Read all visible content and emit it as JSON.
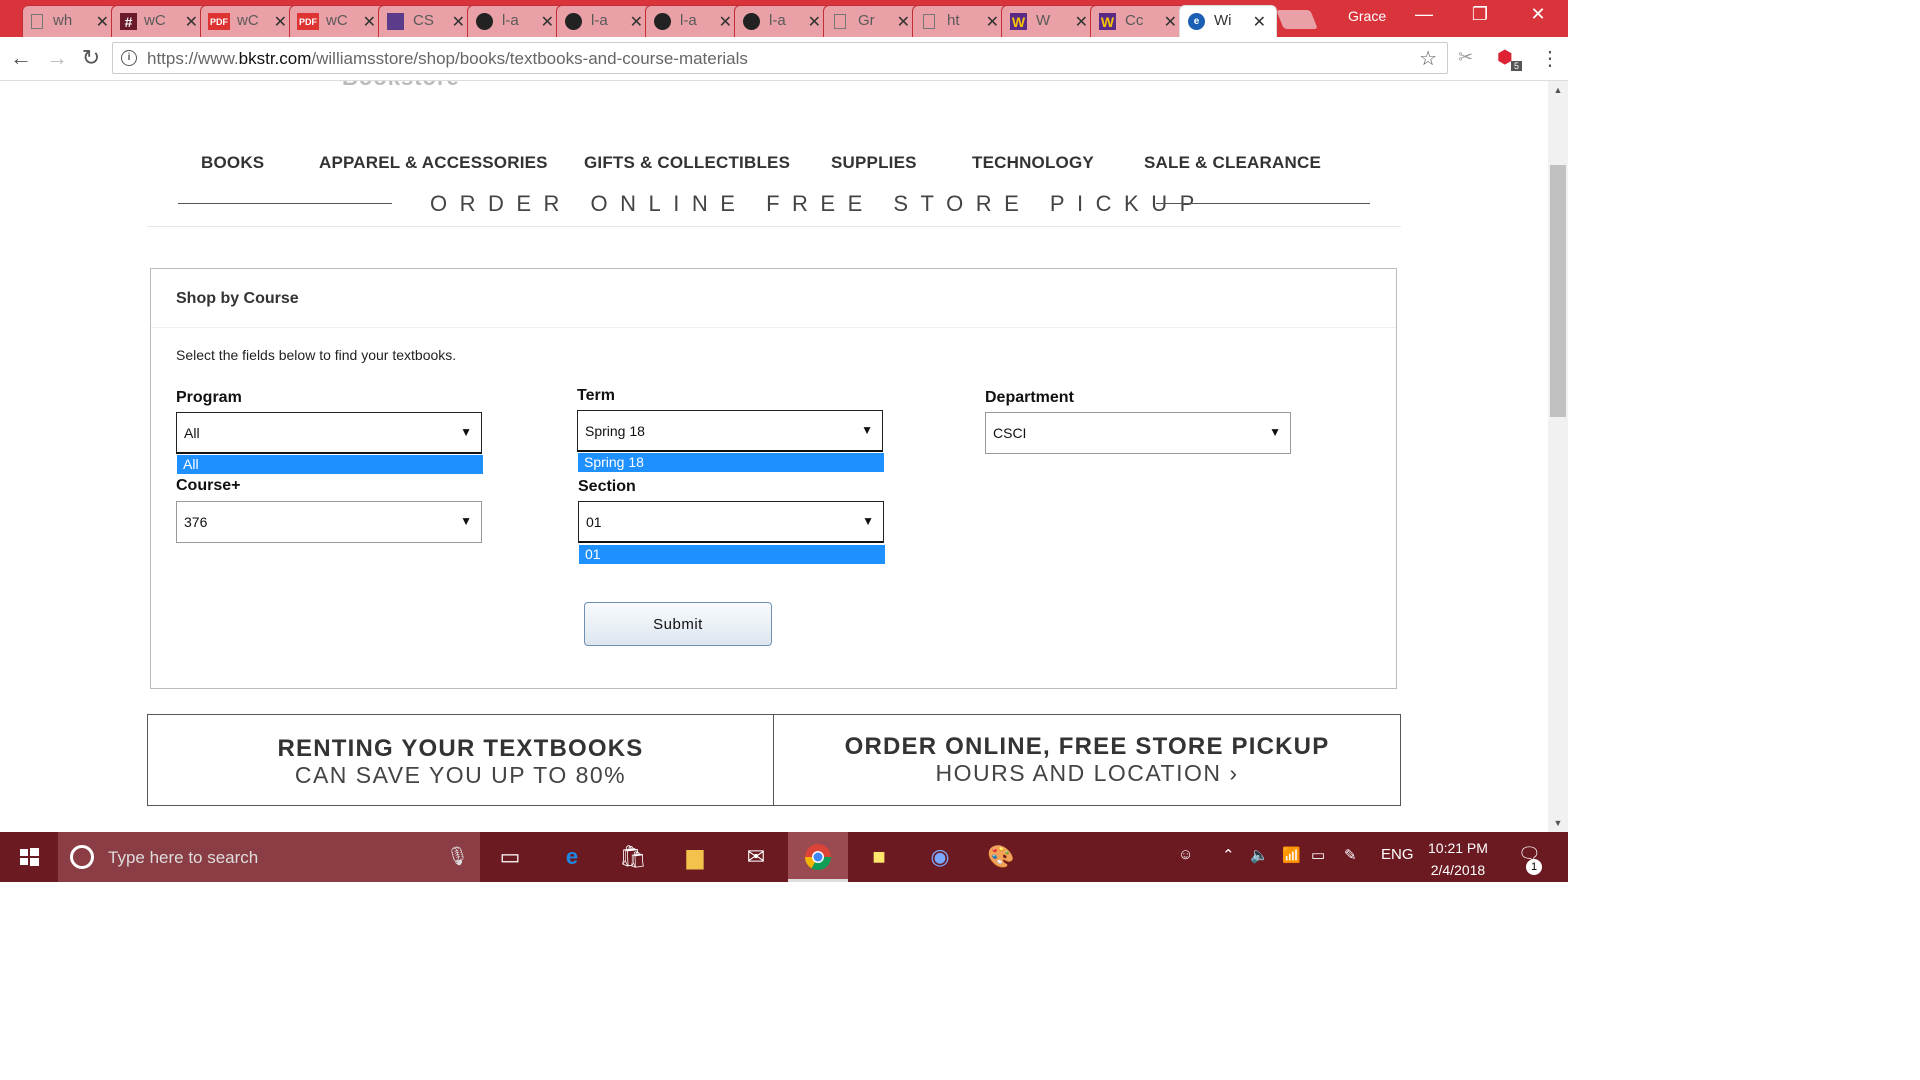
{
  "browser": {
    "tabs": [
      {
        "title": "wh",
        "icon": "document-icon"
      },
      {
        "title": "wC",
        "icon": "hashtag-icon"
      },
      {
        "title": "wC",
        "icon": "pdf-icon"
      },
      {
        "title": "wC",
        "icon": "pdf-icon"
      },
      {
        "title": "CS",
        "icon": "app-icon"
      },
      {
        "title": "l-a",
        "icon": "github-icon"
      },
      {
        "title": "l-a",
        "icon": "github-icon"
      },
      {
        "title": "l-a",
        "icon": "github-icon"
      },
      {
        "title": "l-a",
        "icon": "github-icon"
      },
      {
        "title": "Gr",
        "icon": "document-icon"
      },
      {
        "title": "ht",
        "icon": "document-icon"
      },
      {
        "title": "W",
        "icon": "williams-w-icon"
      },
      {
        "title": "Cc",
        "icon": "williams-w-icon"
      },
      {
        "title": "Wi",
        "icon": "bookstore-icon",
        "active": true
      }
    ],
    "profile_name": "Grace",
    "url_prefix": "https://www.",
    "url_domain": "bkstr.com",
    "url_path": "/williamsstore/shop/books/textbooks-and-course-materials",
    "extension_badge": "5"
  },
  "store": {
    "logo_partial": "Bookstore",
    "nav": [
      "BOOKS",
      "APPAREL & ACCESSORIES",
      "GIFTS & COLLECTIBLES",
      "SUPPLIES",
      "TECHNOLOGY",
      "SALE & CLEARANCE"
    ],
    "tagline": "ORDER ONLINE FREE STORE PICKUP"
  },
  "shop_by_course": {
    "title": "Shop by Course",
    "help_text": "Select the fields below to find your textbooks.",
    "program": {
      "label": "Program",
      "value": "All",
      "open_option": "All"
    },
    "term": {
      "label": "Term",
      "value": "Spring 18",
      "open_option": "Spring 18"
    },
    "department": {
      "label": "Department",
      "value": "CSCI"
    },
    "course": {
      "label": "Course+",
      "value": "376"
    },
    "section": {
      "label": "Section",
      "value": "01",
      "open_option": "01"
    },
    "submit_label": "Submit"
  },
  "promos": [
    {
      "line1": "RENTING YOUR TEXTBOOKS",
      "line2": "CAN SAVE YOU UP TO 80%"
    },
    {
      "line1": "ORDER ONLINE, FREE STORE PICKUP",
      "line2": "HOURS AND LOCATION ›"
    }
  ],
  "taskbar": {
    "search_placeholder": "Type here to search",
    "language": "ENG",
    "time": "10:21 PM",
    "date": "2/4/2018",
    "notification_count": "1"
  },
  "colors": {
    "tabstrip": "#d9343b",
    "taskbar": "#6b1a22",
    "dropdown_highlight": "#1e90ff"
  }
}
